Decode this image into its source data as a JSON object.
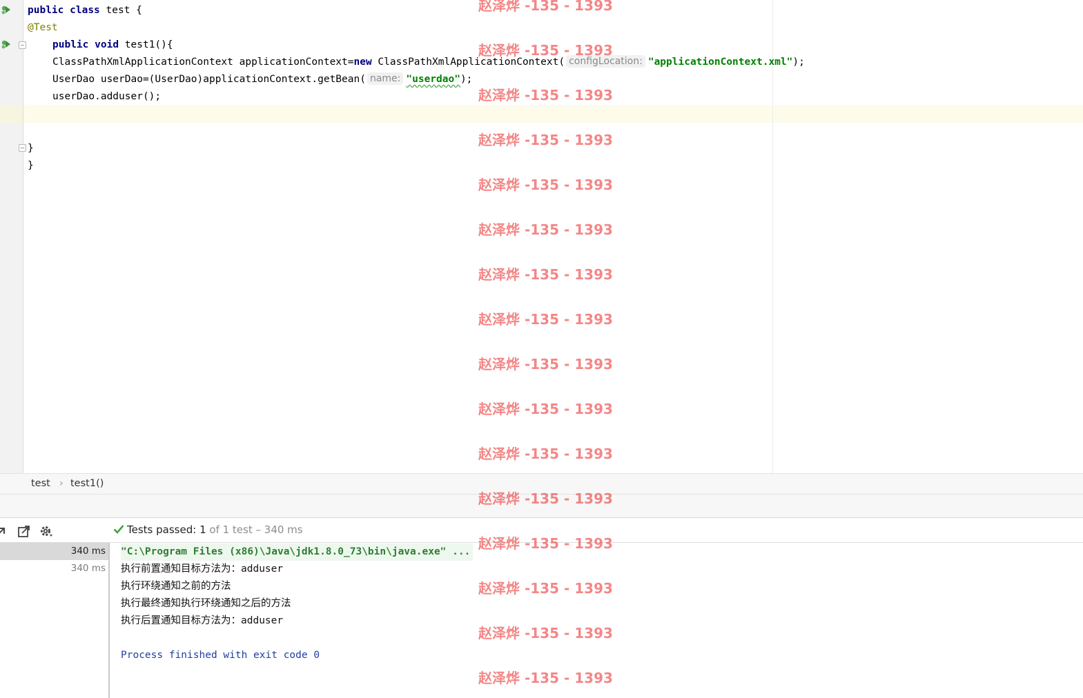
{
  "editor": {
    "code": {
      "l1": {
        "kw1": "public",
        "kw2": "class",
        "rest": " test {"
      },
      "l2": {
        "annotation": "@Test"
      },
      "l3": {
        "kw1": "public",
        "kw2": "void",
        "rest": " test1(){"
      },
      "l4": {
        "pre": "ClassPathXmlApplicationContext applicationContext=",
        "kw": "new",
        "mid": " ClassPathXmlApplicationContext(",
        "hint": "configLocation:",
        "str": "\"applicationContext.xml\"",
        "post": ");"
      },
      "l5": {
        "pre": "UserDao userDao=(UserDao)applicationContext.getBean(",
        "hint": "name:",
        "str": "\"userdao\"",
        "post": ");"
      },
      "l6": {
        "text": "userDao.adduser();"
      },
      "l9": {
        "text": "}"
      },
      "l10": {
        "text": "}"
      }
    }
  },
  "breadcrumb": {
    "items": [
      "test",
      "test1()"
    ],
    "separator": "›"
  },
  "run_panel": {
    "status": {
      "label": "Tests passed:",
      "count": "1",
      "rest": "of 1 test – 340 ms"
    },
    "tree": [
      {
        "time": "340 ms",
        "selected": true
      },
      {
        "time": "340 ms",
        "selected": false
      }
    ],
    "console": {
      "command": "\"C:\\Program Files (x86)\\Java\\jdk1.8.0_73\\bin\\java.exe\" ...",
      "lines": [
        "执行前置通知目标方法为：adduser",
        "执行环绕通知之前的方法",
        "执行最终通知执行环绕通知之后的方法",
        "执行后置通知目标方法为：adduser"
      ],
      "exit": "Process finished with exit code 0"
    }
  },
  "watermark": {
    "text": "赵泽烨 -135 - 1393"
  },
  "colors": {
    "keyword": "#000080",
    "annotation": "#808000",
    "string": "#008000",
    "watermark": "#ee3c3c",
    "pass": "#3ea33e"
  }
}
